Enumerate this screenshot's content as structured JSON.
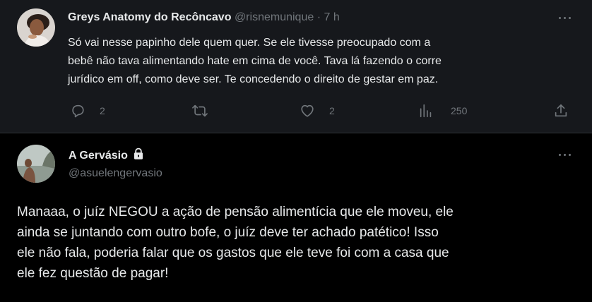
{
  "tweet1": {
    "author_name": "Greys Anatomy do Recôncavo",
    "handle": "@risnemunique",
    "separator": "·",
    "time": "7 h",
    "text": "Só vai nesse papinho dele quem quer. Se ele tivesse preocupado com a\nbebê não tava alimentando hate em cima de você. Tava lá fazendo o corre\njurídico em off, como deve ser. Te concedendo o direito de gestar em paz.",
    "actions": {
      "replies": "2",
      "retweets": "",
      "likes": "2",
      "views": "250"
    }
  },
  "tweet2": {
    "author_name": "A Gervásio",
    "handle": "@asuelengervasio",
    "locked": true,
    "text": "Manaaa, o juíz NEGOU a ação de pensão alimentícia que ele moveu, ele\nainda se juntando com outro bofe, o juíz deve ter achado patético! Isso\nele não fala, poderia falar que os gastos que ele teve foi com a casa que\nele fez questão de pagar!"
  },
  "colors": {
    "text": "#e7e9ea",
    "muted": "#71767b",
    "highlight_bg": "#16181c",
    "bg": "#000000"
  },
  "icons": [
    "more-icon",
    "reply-icon",
    "retweet-icon",
    "like-icon",
    "views-icon",
    "share-icon",
    "lock-icon"
  ]
}
